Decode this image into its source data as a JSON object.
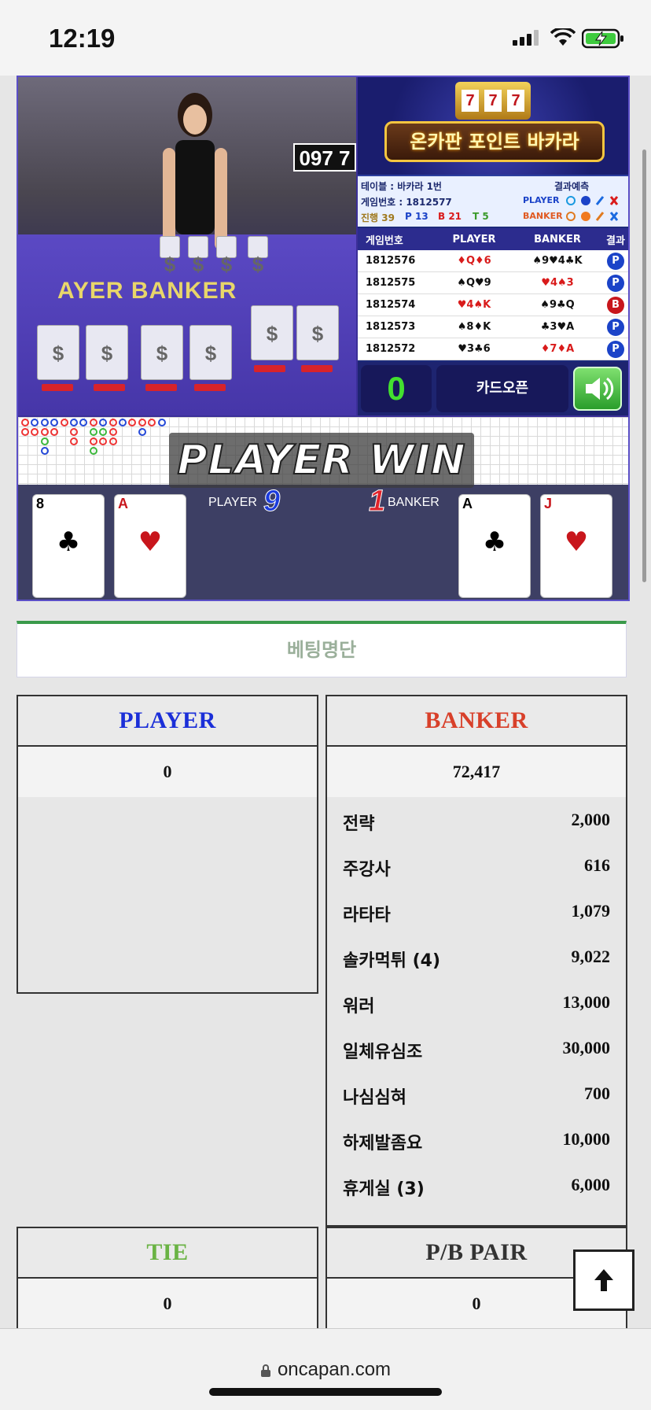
{
  "status": {
    "time": "12:19"
  },
  "video": {
    "overlay_code": "097 7",
    "felt_label": "AYER BANKER"
  },
  "banner": {
    "title": "온카판 포인트 바카라",
    "slot_digits": [
      "7",
      "7",
      "7"
    ]
  },
  "info": {
    "table": "테이블 : 바카라 1번",
    "game_no": "게임번호 : 1812577",
    "progress": "진행 39",
    "p_count": "P 13",
    "b_count": "B 21",
    "t_count": "T 5",
    "predict_label": "결과예측",
    "player_label": "PLAYER",
    "banker_label": "BANKER"
  },
  "history": {
    "headers": [
      "게임번호",
      "PLAYER",
      "BANKER",
      "결과"
    ],
    "rows": [
      {
        "no": "1812576",
        "player": "♦Q♦6",
        "banker": "♠9♥4♣K",
        "result": "P"
      },
      {
        "no": "1812575",
        "player": "♠Q♥9",
        "banker": "♥4♠3",
        "result": "P"
      },
      {
        "no": "1812574",
        "player": "♥4♠K",
        "banker": "♠9♣Q",
        "result": "B"
      },
      {
        "no": "1812573",
        "player": "♠8♦K",
        "banker": "♣3♥A",
        "result": "P"
      },
      {
        "no": "1812572",
        "player": "♥3♣6",
        "banker": "♦7♦A",
        "result": "P"
      }
    ]
  },
  "controls": {
    "counter": "0",
    "open_label": "카드오픈"
  },
  "result_banner": "PLAYER WIN",
  "cards": {
    "player_label": "PLAYER",
    "player_score": "9",
    "banker_label": "BANKER",
    "banker_score": "1",
    "player_cards": [
      {
        "rank": "8",
        "suit": "♣",
        "color": "#111111"
      },
      {
        "rank": "A",
        "suit": "♥",
        "color": "#c8161c"
      }
    ],
    "banker_cards": [
      {
        "rank": "A",
        "suit": "♣",
        "color": "#111111"
      },
      {
        "rank": "J",
        "suit": "♥",
        "color": "#c8161c"
      }
    ]
  },
  "bet_title": "베팅명단",
  "player_box": {
    "title": "PLAYER",
    "total": "0",
    "title_color": "#1b2fd8"
  },
  "banker_box": {
    "title": "BANKER",
    "total": "72,417",
    "title_color": "#d8402a",
    "items": [
      {
        "name": "전략",
        "value": "2,000"
      },
      {
        "name": "주강사",
        "value": "616"
      },
      {
        "name": "라타타",
        "value": "1,079"
      },
      {
        "name": "솔카먹튀 (4)",
        "value": "9,022"
      },
      {
        "name": "워러",
        "value": "13,000"
      },
      {
        "name": "일체유심조",
        "value": "30,000"
      },
      {
        "name": "나심심혀",
        "value": "700"
      },
      {
        "name": "하제발좀요",
        "value": "10,000"
      },
      {
        "name": "휴게실 (3)",
        "value": "6,000"
      }
    ]
  },
  "tie_box": {
    "title": "TIE",
    "total": "0",
    "title_color": "#6ab344"
  },
  "pair_box": {
    "title": "P/B PAIR",
    "total": "0",
    "title_color": "#333333"
  },
  "browser": {
    "url": "oncapan.com"
  },
  "icons": {
    "to_top": "arrow-up-icon",
    "sound": "speaker-icon",
    "lock": "lock-icon"
  }
}
